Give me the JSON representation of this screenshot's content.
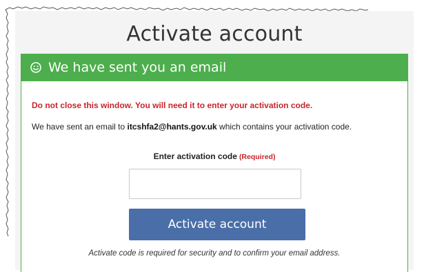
{
  "page": {
    "title": "Activate account"
  },
  "card": {
    "header": "We have sent you an email",
    "warning": "Do not close this window. You will need it to enter your activation code.",
    "info_prefix": "We have sent an email to ",
    "email": "itcshfa2@hants.gov.uk",
    "info_suffix": " which contains your activation code.",
    "field_label": "Enter activation code",
    "required_tag": "(Required)",
    "code_value": "",
    "button_label": "Activate account",
    "help_text": "Activate code is required for security and to confirm your email address."
  },
  "colors": {
    "header_bg": "#4cae4c",
    "button_bg": "#4a6fa8",
    "warning_text": "#c7252b"
  },
  "icons": {
    "header_icon": "smiley-icon"
  }
}
